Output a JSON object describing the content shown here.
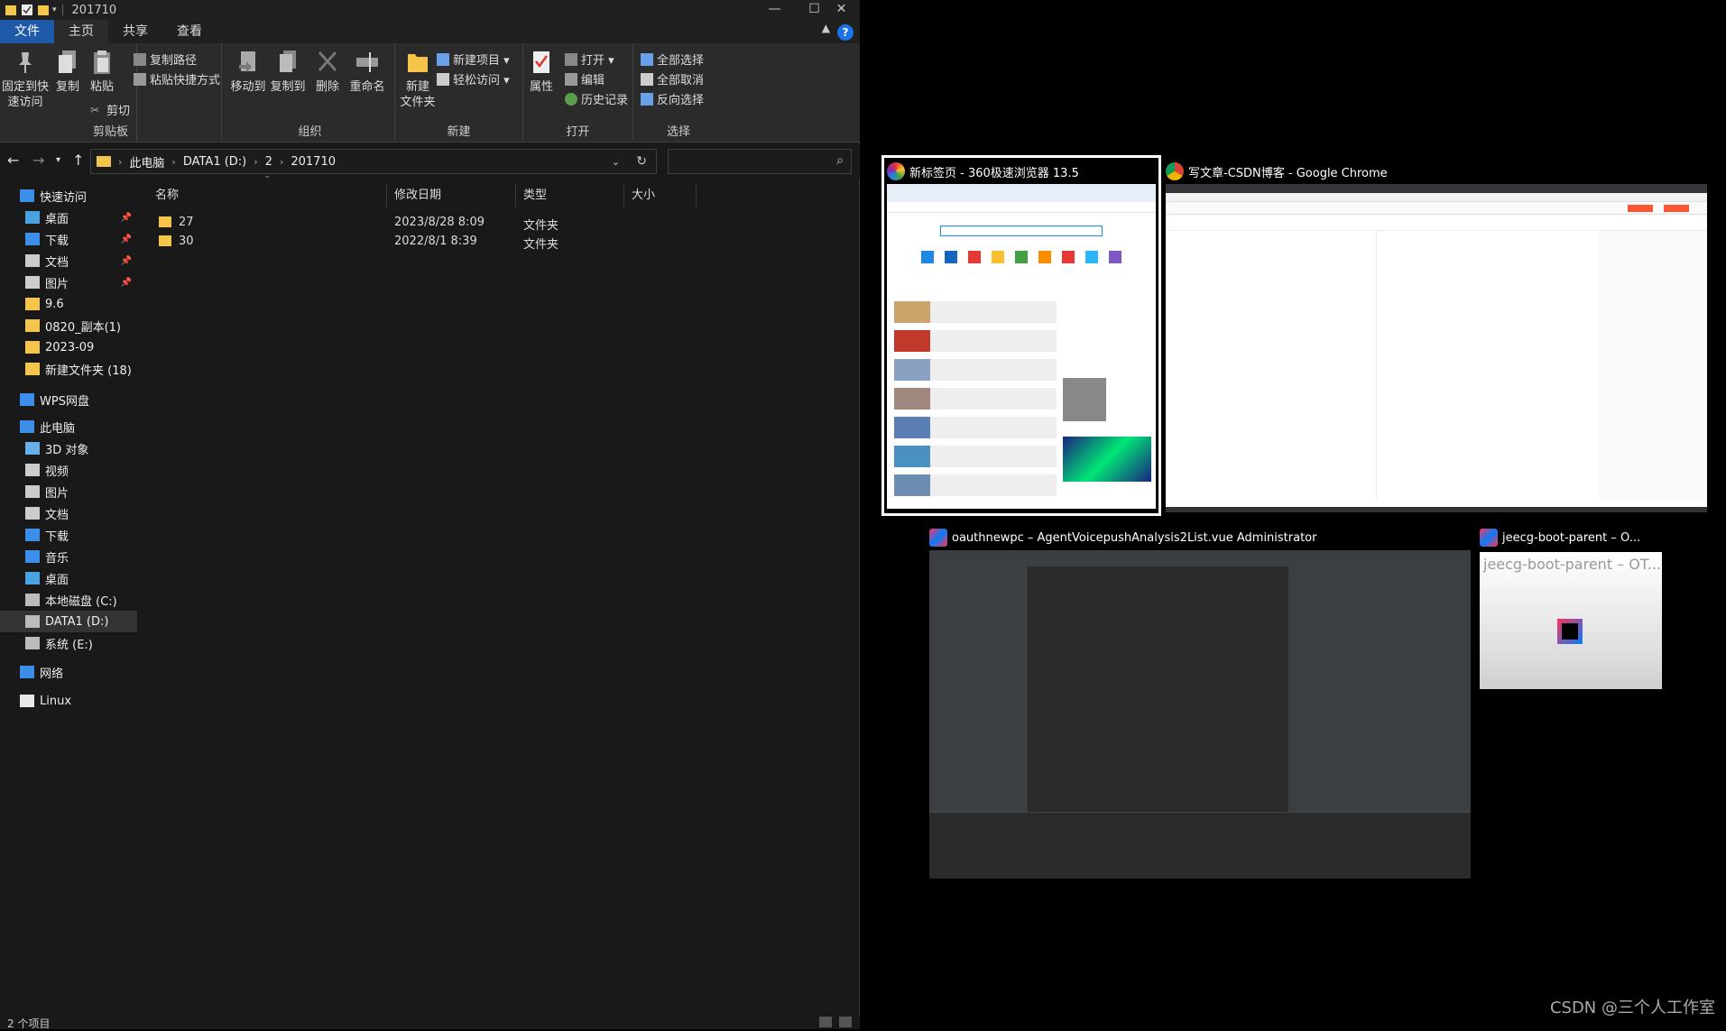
{
  "window": {
    "title": "201710",
    "controls": {
      "minimize": "—",
      "maximize": "☐",
      "close": "✕"
    }
  },
  "tabs": [
    {
      "label": "文件"
    },
    {
      "label": "主页"
    },
    {
      "label": "共享"
    },
    {
      "label": "查看"
    }
  ],
  "help_label": "?",
  "ribbon": {
    "clipboard": {
      "group": "剪贴板",
      "pin_quick_1": "固定到快",
      "pin_quick_2": "速访问",
      "copy": "复制",
      "paste": "粘贴",
      "copy_path": "复制路径",
      "paste_shortcut": "粘贴快捷方式",
      "cut": "剪切"
    },
    "organize": {
      "group": "组织",
      "move_to": "移动到",
      "copy_to": "复制到",
      "delete": "删除",
      "rename": "重命名"
    },
    "new": {
      "group": "新建",
      "new_folder_1": "新建",
      "new_folder_2": "文件夹",
      "new_item": "新建项目 ▾",
      "easy_access": "轻松访问 ▾"
    },
    "open": {
      "group": "打开",
      "properties": "属性",
      "open": "打开 ▾",
      "edit": "编辑",
      "history": "历史记录"
    },
    "select": {
      "group": "选择",
      "select_all": "全部选择",
      "select_none": "全部取消",
      "invert": "反向选择"
    }
  },
  "address": {
    "crumbs": [
      "此电脑",
      "DATA1 (D:)",
      "2",
      "201710"
    ]
  },
  "nav_pane": [
    {
      "label": "快速访问",
      "icon": "star-icon",
      "pinned": false,
      "indent": 1
    },
    {
      "label": "桌面",
      "icon": "desktop-icon",
      "pinned": true,
      "indent": 2
    },
    {
      "label": "下载",
      "icon": "download-icon",
      "pinned": true,
      "indent": 2
    },
    {
      "label": "文档",
      "icon": "document-icon",
      "pinned": true,
      "indent": 2
    },
    {
      "label": "图片",
      "icon": "picture-icon",
      "pinned": true,
      "indent": 2
    },
    {
      "label": "9.6",
      "icon": "folder-icon",
      "pinned": false,
      "indent": 2
    },
    {
      "label": "0820_副本(1)",
      "icon": "folder-icon",
      "pinned": false,
      "indent": 2
    },
    {
      "label": "2023-09",
      "icon": "folder-icon",
      "pinned": false,
      "indent": 2
    },
    {
      "label": "新建文件夹 (18)",
      "icon": "folder-icon",
      "pinned": false,
      "indent": 2
    },
    {
      "label": "WPS网盘",
      "icon": "cloud-icon",
      "pinned": false,
      "indent": 1
    },
    {
      "label": "此电脑",
      "icon": "computer-icon",
      "pinned": false,
      "indent": 1
    },
    {
      "label": "3D 对象",
      "icon": "cube-icon",
      "pinned": false,
      "indent": 2
    },
    {
      "label": "视频",
      "icon": "video-icon",
      "pinned": false,
      "indent": 2
    },
    {
      "label": "图片",
      "icon": "picture-icon",
      "pinned": false,
      "indent": 2
    },
    {
      "label": "文档",
      "icon": "document-icon",
      "pinned": false,
      "indent": 2
    },
    {
      "label": "下载",
      "icon": "download-icon",
      "pinned": false,
      "indent": 2
    },
    {
      "label": "音乐",
      "icon": "music-icon",
      "pinned": false,
      "indent": 2
    },
    {
      "label": "桌面",
      "icon": "desktop-icon",
      "pinned": false,
      "indent": 2
    },
    {
      "label": "本地磁盘 (C:)",
      "icon": "drive-icon",
      "pinned": false,
      "indent": 2
    },
    {
      "label": "DATA1 (D:)",
      "icon": "drive-icon",
      "pinned": false,
      "indent": 2
    },
    {
      "label": "系统 (E:)",
      "icon": "drive-icon",
      "pinned": false,
      "indent": 2
    },
    {
      "label": "网络",
      "icon": "network-icon",
      "pinned": false,
      "indent": 1
    },
    {
      "label": "Linux",
      "icon": "linux-icon",
      "pinned": false,
      "indent": 1
    }
  ],
  "columns": {
    "name": "名称",
    "modified": "修改日期",
    "type": "类型",
    "size": "大小"
  },
  "files": [
    {
      "name": "27",
      "modified": "2023/8/28 8:09",
      "type": "文件夹"
    },
    {
      "name": "30",
      "modified": "2022/8/1 8:39",
      "type": "文件夹"
    }
  ],
  "status": {
    "count": "2 个项目"
  },
  "alt_tab": [
    {
      "title": "新标签页 - 360极速浏览器 13.5",
      "icon": "360-browser-icon",
      "selected": true
    },
    {
      "title": "写文章-CSDN博客 - Google Chrome",
      "icon": "chrome-icon",
      "selected": false
    },
    {
      "title": "oauthnewpc – AgentVoicepushAnalysis2List.vue Administrator",
      "icon": "intellij-icon",
      "selected": false
    },
    {
      "title": "jeecg-boot-parent – O...",
      "icon": "intellij-icon",
      "selected": false
    }
  ],
  "idea_thumb_text": "jeecg-boot-parent – OT...",
  "watermark": "CSDN @三个人工作室",
  "colors": {
    "accent": "#1f5aa8",
    "folder": "#f5c44b",
    "bg_dark": "#191919",
    "ribbon_bg": "#2b2b2b"
  }
}
